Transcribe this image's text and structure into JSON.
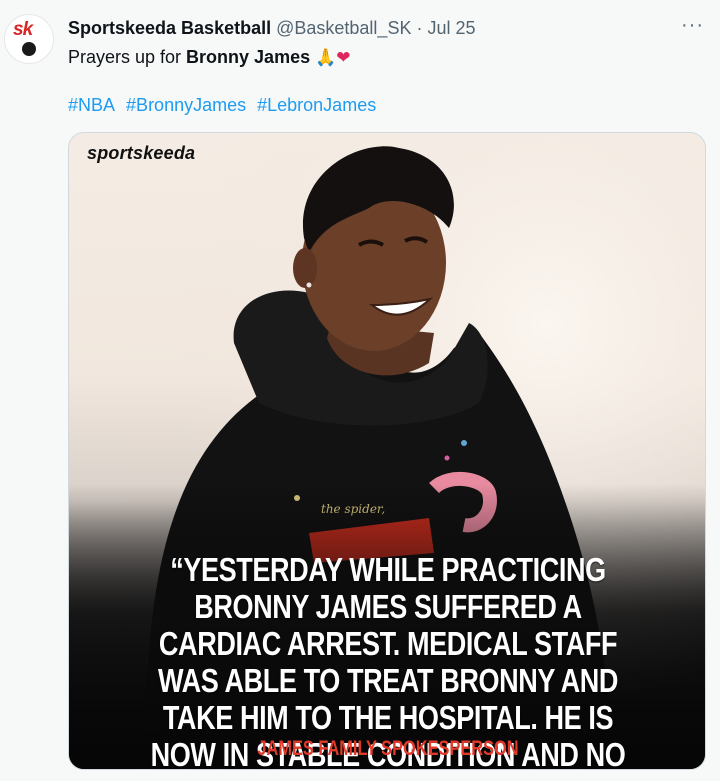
{
  "tweet": {
    "author_name": "Sportskeeda Basketball",
    "handle": "@Basketball_SK",
    "separator": "·",
    "timestamp": "Jul 25",
    "more_label": "···",
    "text_prefix": "Prayers up for ",
    "text_bold": "Bronny James",
    "emoji_pray": "🙏",
    "emoji_heart": "❤",
    "hashtags": [
      "#NBA",
      "#BronnyJames",
      "#LebronJames"
    ]
  },
  "avatar": {
    "logo_text": "sk"
  },
  "media": {
    "watermark": "sportskeeda",
    "quote": "“YESTERDAY WHILE PRACTICING BRONNY JAMES SUFFERED A CARDIAC ARREST. MEDICAL STAFF WAS ABLE TO TREAT BRONNY AND TAKE HIM TO THE HOSPITAL. HE IS NOW IN STABLE CONDITION AND NO LONGER IN ICU.”",
    "attribution": "JAMES FAMILY SPOKESPERSON"
  },
  "colors": {
    "accent": "#1d9bf0",
    "brand_red": "#d62828",
    "attribution_red": "#e23a2a",
    "background": "#f7f9f9"
  }
}
